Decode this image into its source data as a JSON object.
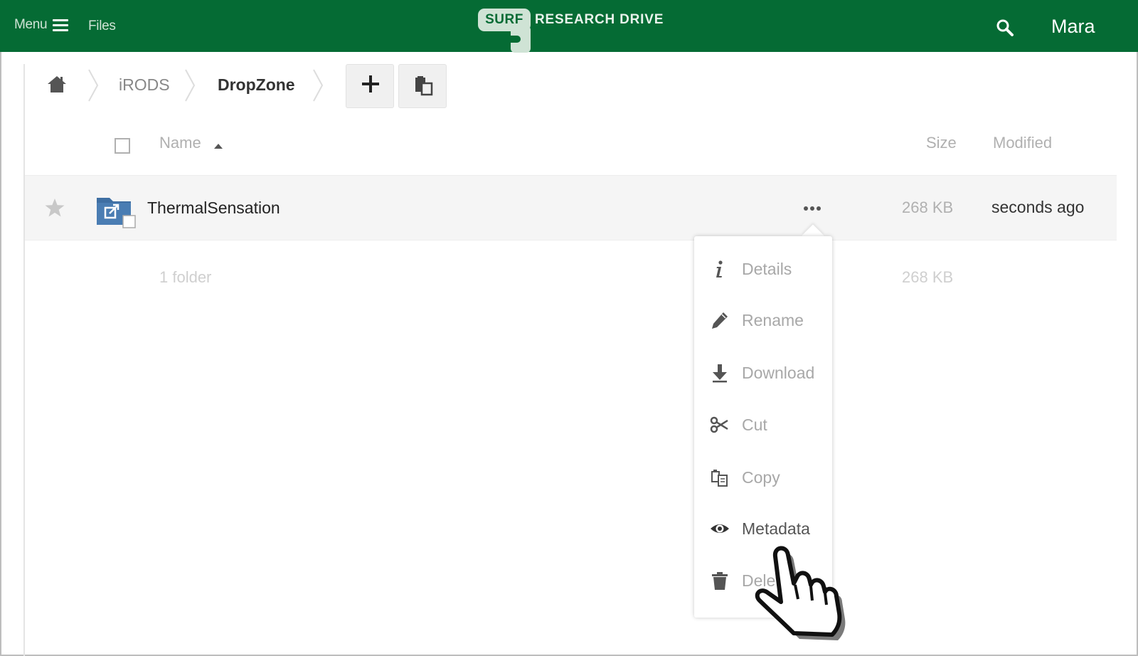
{
  "header": {
    "menu_label": "Menu",
    "files_label": "Files",
    "logo_badge": "SURF",
    "logo_text": "RESEARCH DRIVE",
    "user_name": "Mara",
    "colors": {
      "bar": "#056b34",
      "logo": "#cfe3d5"
    }
  },
  "breadcrumb": {
    "items": [
      {
        "label": "iRODS"
      },
      {
        "label": "DropZone"
      }
    ]
  },
  "table": {
    "columns": {
      "name": "Name",
      "size": "Size",
      "modified": "Modified"
    },
    "rows": [
      {
        "name": "ThermalSensation",
        "size": "268 KB",
        "modified": "seconds ago",
        "icon": "external-folder-icon"
      }
    ],
    "summary": {
      "label": "1 folder",
      "size": "268 KB"
    }
  },
  "context_menu": {
    "items": [
      {
        "label": "Details",
        "icon": "info-icon"
      },
      {
        "label": "Rename",
        "icon": "pencil-icon"
      },
      {
        "label": "Download",
        "icon": "download-icon"
      },
      {
        "label": "Cut",
        "icon": "scissors-icon"
      },
      {
        "label": "Copy",
        "icon": "copy-icon"
      },
      {
        "label": "Metadata",
        "icon": "eye-icon"
      },
      {
        "label": "Delete",
        "icon": "trash-icon"
      }
    ]
  }
}
